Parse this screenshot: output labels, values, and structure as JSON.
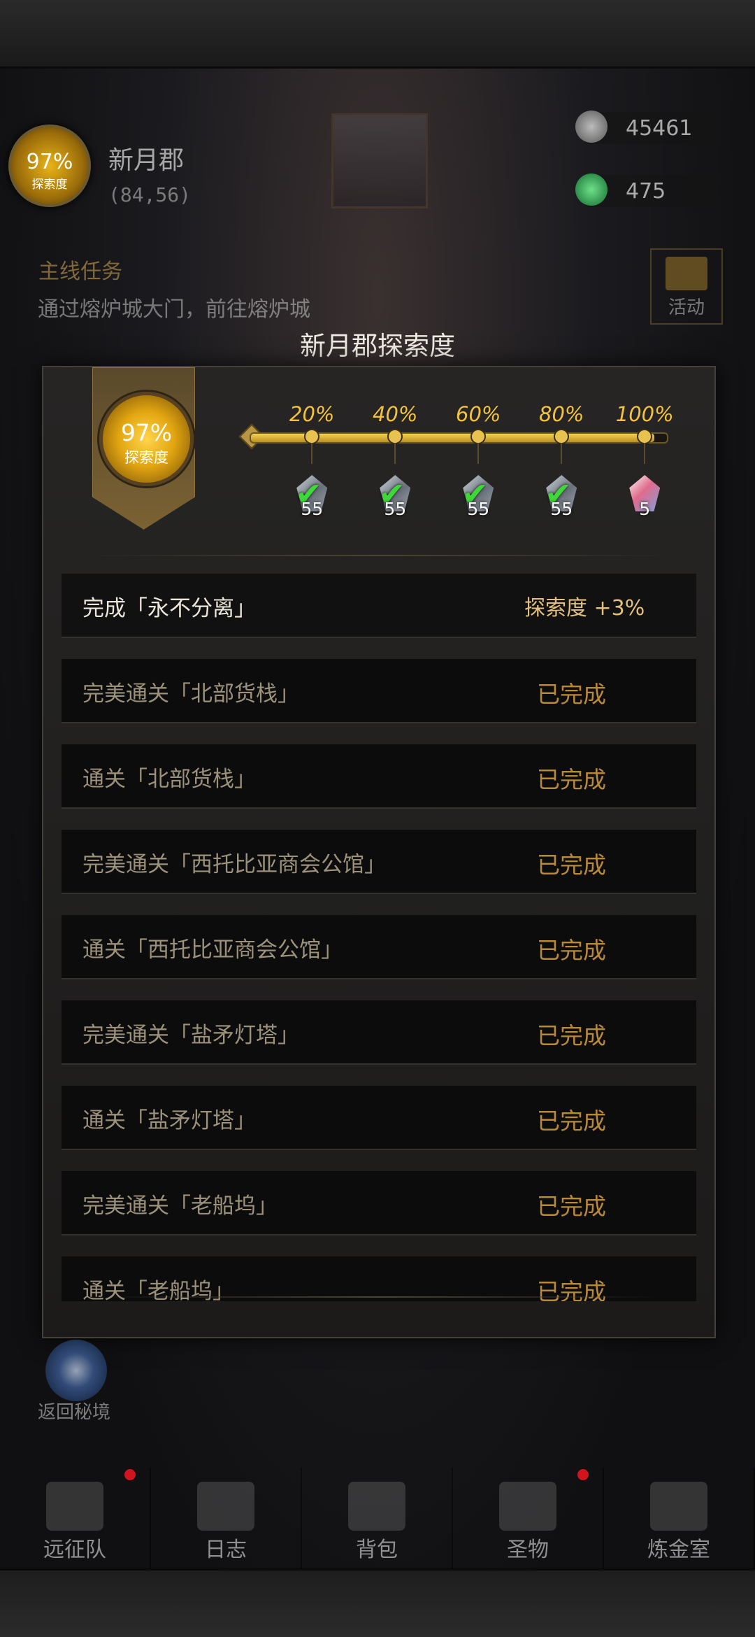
{
  "hud": {
    "region_percent": "97%",
    "region_label": "探索度",
    "region_name": "新月郡",
    "region_coords": "(84,56)",
    "resources": [
      {
        "icon": "ore-icon",
        "value": "45461"
      },
      {
        "icon": "emerald-icon",
        "value": "475"
      }
    ],
    "quest_title": "主线任务",
    "quest_text": "通过熔炉城大门，前往熔炉城",
    "activity_label": "活动",
    "return_label": "返回秘境"
  },
  "modal": {
    "title": "新月郡探索度",
    "badge_percent": "97%",
    "badge_label": "探索度",
    "progress_value": 0.97,
    "milestones": [
      {
        "label": "20%",
        "reward_qty": "55",
        "reward_icon": "ore-gem-icon",
        "claimed": true
      },
      {
        "label": "40%",
        "reward_qty": "55",
        "reward_icon": "ore-gem-icon",
        "claimed": true
      },
      {
        "label": "60%",
        "reward_qty": "55",
        "reward_icon": "ore-gem-icon",
        "claimed": true
      },
      {
        "label": "80%",
        "reward_qty": "55",
        "reward_icon": "ore-gem-icon",
        "claimed": true
      },
      {
        "label": "100%",
        "reward_qty": "5",
        "reward_icon": "crystal-gem-icon",
        "claimed": false
      }
    ],
    "tasks": [
      {
        "name": "完成「永不分离」",
        "status": "探索度 +3%"
      },
      {
        "name": "完美通关「北部货栈」",
        "status": "已完成"
      },
      {
        "name": "通关「北部货栈」",
        "status": "已完成"
      },
      {
        "name": "完美通关「西托比亚商会公馆」",
        "status": "已完成"
      },
      {
        "name": "通关「西托比亚商会公馆」",
        "status": "已完成"
      },
      {
        "name": "完美通关「盐矛灯塔」",
        "status": "已完成"
      },
      {
        "name": "通关「盐矛灯塔」",
        "status": "已完成"
      },
      {
        "name": "完美通关「老船坞」",
        "status": "已完成"
      },
      {
        "name": "通关「老船坞」",
        "status": "已完成"
      }
    ]
  },
  "nav": [
    {
      "label": "远征队",
      "badge": true
    },
    {
      "label": "日志",
      "badge": false
    },
    {
      "label": "背包",
      "badge": false
    },
    {
      "label": "圣物",
      "badge": true
    },
    {
      "label": "炼金室",
      "badge": false
    }
  ],
  "colors": {
    "accent_gold": "#f3c33a",
    "done_text": "#b9893a",
    "check_green": "#3fd83a",
    "badge_red": "#d2141e"
  }
}
